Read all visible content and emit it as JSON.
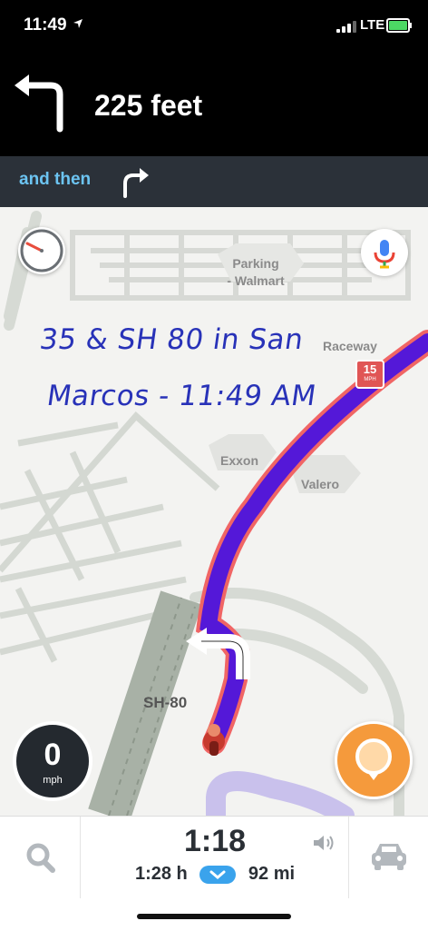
{
  "status_bar": {
    "time": "11:49",
    "network": "LTE"
  },
  "navigation": {
    "distance": "225 feet",
    "then_label": "and then",
    "current_turn_icon": "turn-left-icon",
    "next_turn_icon": "turn-right-icon"
  },
  "map": {
    "poi_parking": "Parking\n- Walmart",
    "poi_raceway": "Raceway",
    "poi_exxon": "Exxon",
    "poi_valero": "Valero",
    "road_label": "SH-80",
    "speed_limit": "15",
    "speed_limit_unit": "MPH",
    "handwritten_line1": "35 & SH 80 in San",
    "handwritten_line2": "Marcos - 11:49 AM",
    "route_color": "#6b12e6"
  },
  "speedometer": {
    "speed": "0",
    "unit": "mph"
  },
  "trip": {
    "arrival_time": "1:18",
    "duration": "1:28 h",
    "distance": "92 mi"
  },
  "colors": {
    "accent": "#6cc4f2",
    "report_button": "#f59a3c"
  }
}
